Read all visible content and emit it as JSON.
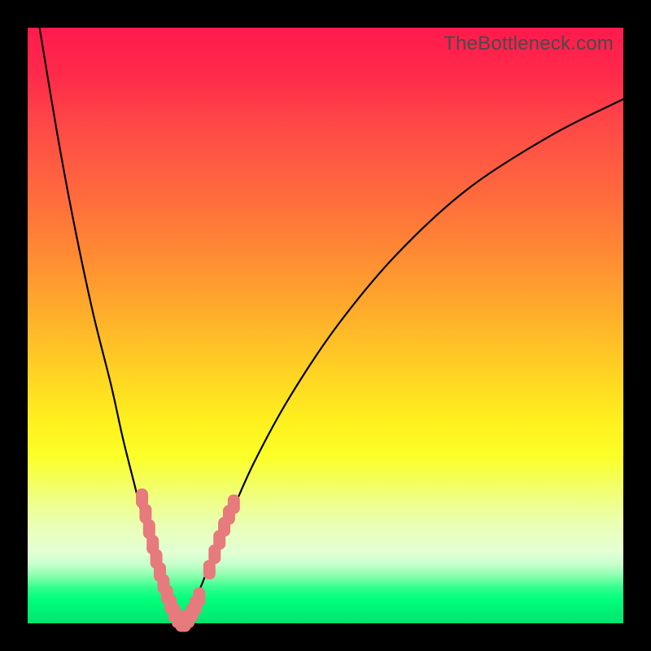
{
  "watermark": "TheBottleneck.com",
  "chart_data": {
    "type": "line",
    "title": "",
    "xlabel": "",
    "ylabel": "",
    "xlim": [
      0,
      100
    ],
    "ylim": [
      0,
      100
    ],
    "grid": false,
    "legend": false,
    "background_gradient": {
      "top": "#ff1a4d",
      "mid": "#fff01e",
      "bottom": "#00e46e"
    },
    "series": [
      {
        "name": "bottleneck-curve",
        "color": "#000000",
        "x": [
          2,
          5,
          8,
          11,
          14,
          16,
          18,
          19.5,
          21,
          22.5,
          24,
          25.5,
          27,
          29,
          31,
          34,
          38,
          44,
          52,
          62,
          74,
          88,
          100
        ],
        "y": [
          100,
          82,
          66,
          52,
          40,
          31,
          23,
          17,
          11,
          6,
          2,
          0,
          2,
          6,
          11,
          18,
          27,
          38,
          50,
          62,
          73,
          82,
          88
        ]
      }
    ],
    "markers": {
      "name": "highlighted-segments",
      "color": "#e77a7d",
      "points": [
        {
          "x": 19.2,
          "y": 21.0
        },
        {
          "x": 19.8,
          "y": 18.4
        },
        {
          "x": 20.4,
          "y": 15.8
        },
        {
          "x": 21.0,
          "y": 13.2
        },
        {
          "x": 21.6,
          "y": 10.8
        },
        {
          "x": 22.2,
          "y": 8.6
        },
        {
          "x": 22.8,
          "y": 6.6
        },
        {
          "x": 23.4,
          "y": 4.8
        },
        {
          "x": 24.0,
          "y": 3.2
        },
        {
          "x": 24.6,
          "y": 1.8
        },
        {
          "x": 25.2,
          "y": 0.8
        },
        {
          "x": 25.8,
          "y": 0.2
        },
        {
          "x": 26.4,
          "y": 0.2
        },
        {
          "x": 27.0,
          "y": 0.8
        },
        {
          "x": 27.6,
          "y": 1.8
        },
        {
          "x": 28.2,
          "y": 3.0
        },
        {
          "x": 28.8,
          "y": 4.4
        },
        {
          "x": 30.5,
          "y": 9.0
        },
        {
          "x": 31.4,
          "y": 11.6
        },
        {
          "x": 32.2,
          "y": 14.0
        },
        {
          "x": 33.0,
          "y": 16.2
        },
        {
          "x": 33.8,
          "y": 18.2
        },
        {
          "x": 34.6,
          "y": 20.0
        }
      ]
    }
  }
}
